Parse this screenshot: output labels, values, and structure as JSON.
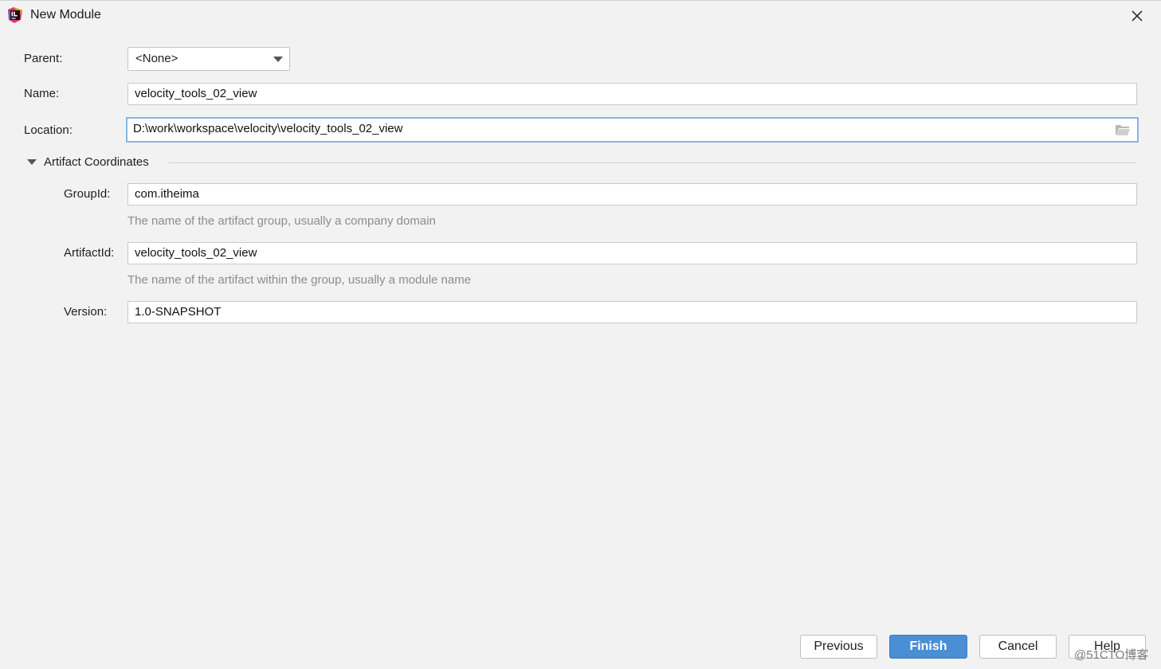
{
  "window": {
    "title": "New Module"
  },
  "form": {
    "parent": {
      "label": "Parent:",
      "value": "<None>"
    },
    "name": {
      "label": "Name:",
      "value": "velocity_tools_02_view"
    },
    "location": {
      "label": "Location:",
      "value": "D:\\work\\workspace\\velocity\\velocity_tools_02_view"
    }
  },
  "artifact": {
    "section_title": "Artifact Coordinates",
    "group_id": {
      "label": "GroupId:",
      "value": "com.itheima",
      "hint": "The name of the artifact group, usually a company domain"
    },
    "artifact_id": {
      "label": "ArtifactId:",
      "value": "velocity_tools_02_view",
      "hint": "The name of the artifact within the group, usually a module name"
    },
    "version": {
      "label": "Version:",
      "value": "1.0-SNAPSHOT"
    }
  },
  "buttons": {
    "previous": "Previous",
    "finish": "Finish",
    "cancel": "Cancel",
    "help": "Help"
  },
  "watermark": "@51CTO博客",
  "icons": {
    "app": "intellij-idea-icon",
    "close": "close-icon",
    "dropdown": "chevron-down-icon",
    "folder": "folder-icon",
    "collapse": "triangle-down-icon"
  },
  "colors": {
    "primary": "#4a8fd6",
    "focus": "#8ab4e6",
    "hint": "#8c8c8c"
  }
}
